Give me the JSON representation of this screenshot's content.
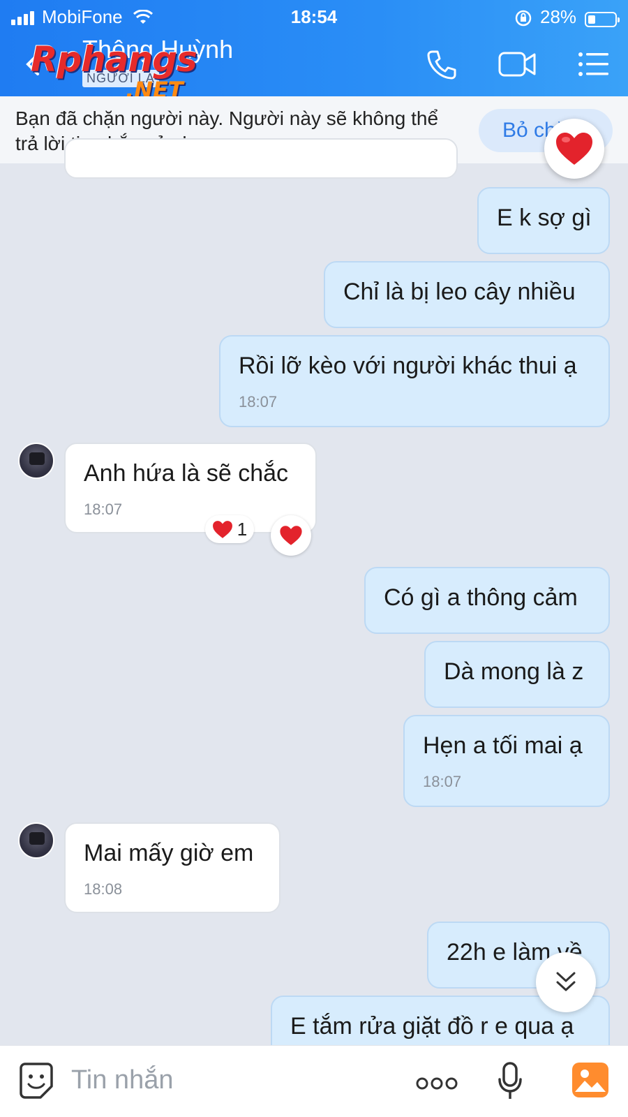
{
  "status_bar": {
    "carrier": "MobiFone",
    "time": "18:54",
    "battery": "28%"
  },
  "header": {
    "contact_name": "Thông Huỳnh",
    "contact_subtitle": "NGƯỜI LẠ",
    "watermark_brand": "Rphangs",
    "watermark_tld": ".NET"
  },
  "blocked_banner": {
    "message": "Bạn đã chặn người này. Người này sẽ không thể trả lời tin nhắn của bạn.",
    "unblock_label": "Bỏ chặn"
  },
  "messages": [
    {
      "dir": "out",
      "text": "E k sợ gì",
      "time": ""
    },
    {
      "dir": "out",
      "text": "Chỉ là bị leo cây nhiều",
      "time": ""
    },
    {
      "dir": "out",
      "text": "Rồi lỡ kèo với người khác thui ạ",
      "time": "18:07"
    },
    {
      "dir": "in",
      "text": "Anh hứa là sẽ chắc",
      "time": "18:07",
      "reaction_count": "1"
    },
    {
      "dir": "out",
      "text": "Có gì a thông cảm",
      "time": ""
    },
    {
      "dir": "out",
      "text": "Dà mong là z",
      "time": ""
    },
    {
      "dir": "out",
      "text": "Hẹn a tối mai ạ",
      "time": "18:07"
    },
    {
      "dir": "in",
      "text": "Mai mấy giờ em",
      "time": "18:08"
    },
    {
      "dir": "out",
      "text": "22h e làm về",
      "time": ""
    },
    {
      "dir": "out",
      "text": "E tắm rửa giặt đồ r e qua ạ",
      "time": ""
    }
  ],
  "composer": {
    "placeholder": "Tin nhắn"
  },
  "colors": {
    "header": "#2a8ef6",
    "outgoing_bubble": "#d7ecfd",
    "incoming_bubble": "#ffffff",
    "chat_background": "#e2e6ee",
    "accent": "#2f7be6"
  },
  "icons": [
    "back-arrow-icon",
    "phone-icon",
    "video-camera-icon",
    "menu-list-icon",
    "heart-icon",
    "chevron-double-down-icon",
    "sticker-icon",
    "more-icon",
    "microphone-icon",
    "image-icon"
  ]
}
